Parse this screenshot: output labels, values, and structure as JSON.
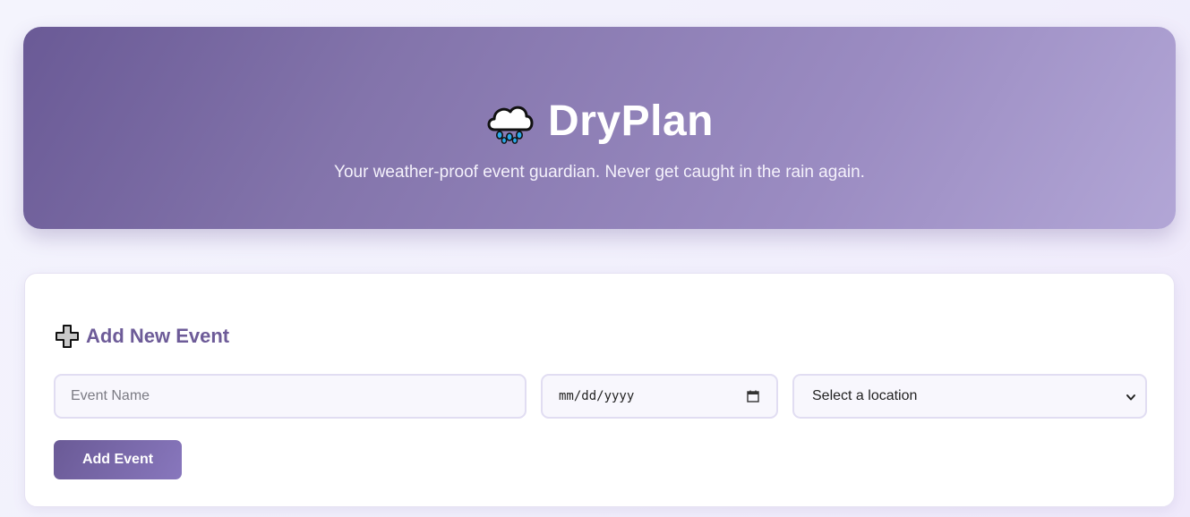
{
  "hero": {
    "title": "DryPlan",
    "subtitle": "Your weather-proof event guardian. Never get caught in the rain again.",
    "icon": "cloud-rain-icon"
  },
  "form": {
    "heading": "Add New Event",
    "heading_icon": "plus-icon",
    "event_name": {
      "placeholder": "Event Name",
      "value": ""
    },
    "date": {
      "placeholder": "mm/dd/yyyy",
      "icon": "calendar-icon"
    },
    "location": {
      "selected": "Select a location",
      "icon": "chevron-down-icon"
    },
    "submit_label": "Add Event"
  },
  "colors": {
    "accent": "#6d5b98",
    "hero_start": "#6a5a96",
    "hero_end": "#b2a6d6",
    "card_bg": "#ffffff"
  }
}
